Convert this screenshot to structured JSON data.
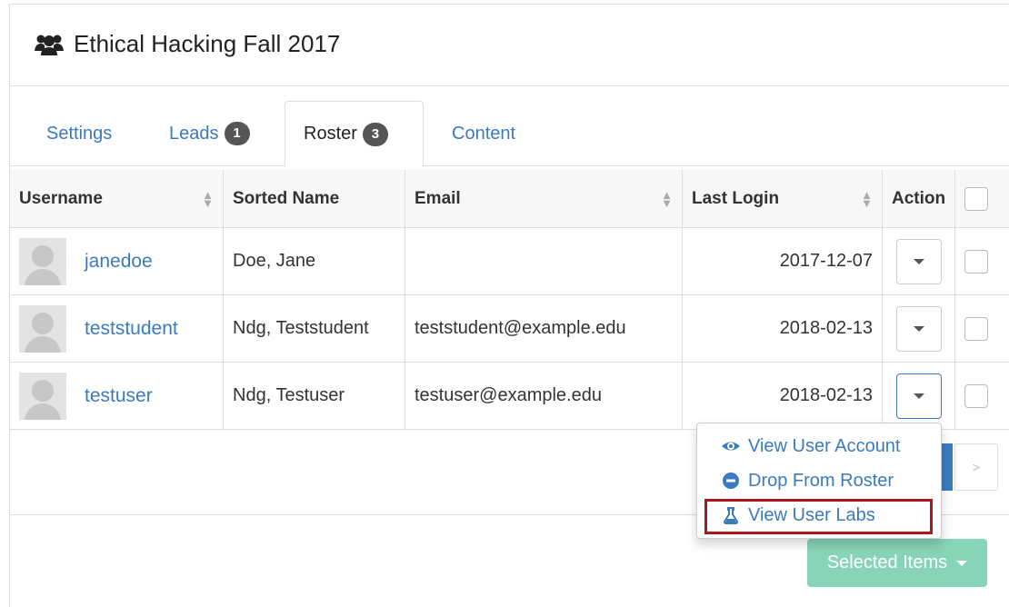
{
  "panel": {
    "title": "Ethical Hacking Fall 2017",
    "title_icon": "users-icon"
  },
  "tabs": [
    {
      "label": "Settings",
      "badge": ""
    },
    {
      "label": "Leads",
      "badge": "1"
    },
    {
      "label": "Roster",
      "badge": "3",
      "active": true
    },
    {
      "label": "Content",
      "badge": ""
    }
  ],
  "table": {
    "headers": [
      "Username",
      "Sorted Name",
      "Email",
      "Last Login",
      "Action"
    ],
    "rows": [
      {
        "username": "janedoe",
        "sorted_name": "Doe, Jane",
        "email": "",
        "last_login": "2017-12-07"
      },
      {
        "username": "teststudent",
        "sorted_name": "Ndg, Teststudent",
        "email": "teststudent@example.edu",
        "last_login": "2018-02-13"
      },
      {
        "username": "testuser",
        "sorted_name": "Ndg, Testuser",
        "email": "testuser@example.edu",
        "last_login": "2018-02-13"
      }
    ]
  },
  "action_menu": {
    "items": [
      {
        "label": "View User Account",
        "icon": "eye-icon"
      },
      {
        "label": "Drop From Roster",
        "icon": "minus-circle-icon"
      },
      {
        "label": "View User Labs",
        "icon": "flask-icon"
      }
    ]
  },
  "pagination": {
    "next_label": ">"
  },
  "footer": {
    "selected_items_label": "Selected Items"
  },
  "colors": {
    "link": "#3a7bbf",
    "badge": "#555555",
    "selected_button": "#88d4b8",
    "highlight": "#b0151c"
  }
}
